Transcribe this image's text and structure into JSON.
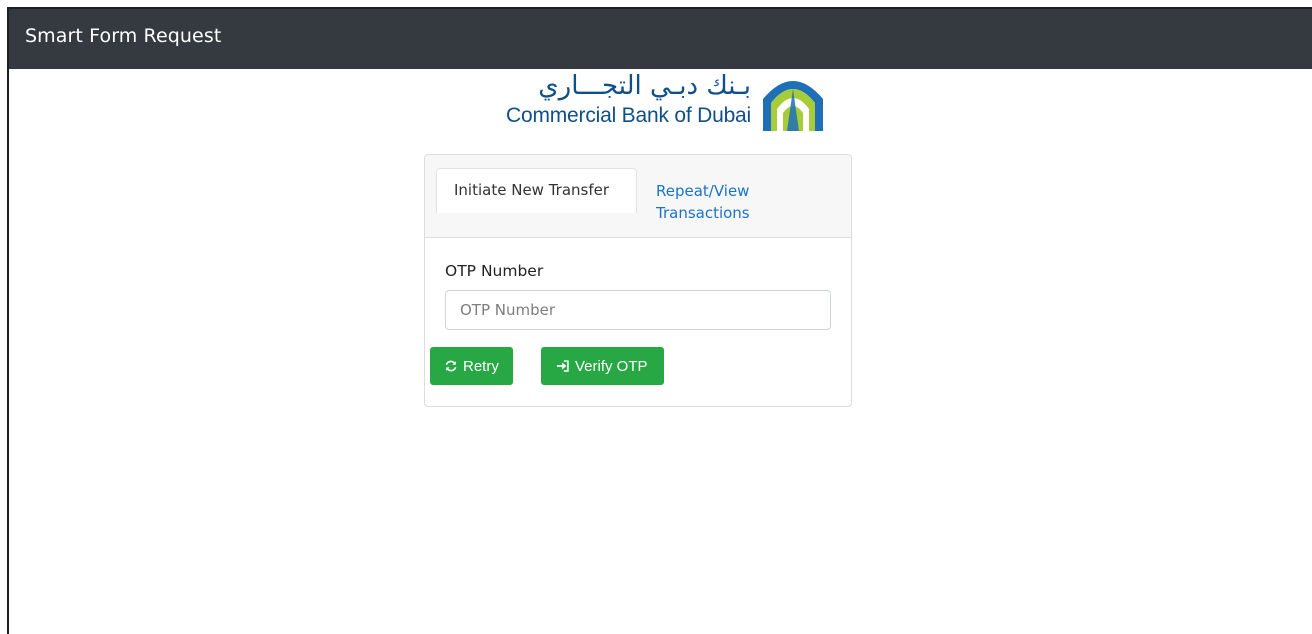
{
  "navbar": {
    "title": "Smart Form Request"
  },
  "logo": {
    "arabic_text": "بـنك دبـي التجـــاري",
    "english_text": "Commercial Bank of Dubai",
    "colors": {
      "text": "#0f4f8a",
      "accent_green": "#a6cd39",
      "accent_blue": "#1e6fb8"
    }
  },
  "tabs": [
    {
      "label": "Initiate New Transfer",
      "active": true
    },
    {
      "label": "Repeat/View Transactions",
      "active": false
    }
  ],
  "form": {
    "otp_label": "OTP Number",
    "otp_value": "",
    "otp_placeholder": "OTP Number"
  },
  "buttons": {
    "retry": {
      "label": "Retry",
      "icon": "refresh-icon"
    },
    "verify": {
      "label": "Verify OTP",
      "icon": "sign-in-icon"
    }
  },
  "colors": {
    "navbar": "#343a40",
    "button_green": "#28a745",
    "link_blue": "#1a73c7"
  }
}
